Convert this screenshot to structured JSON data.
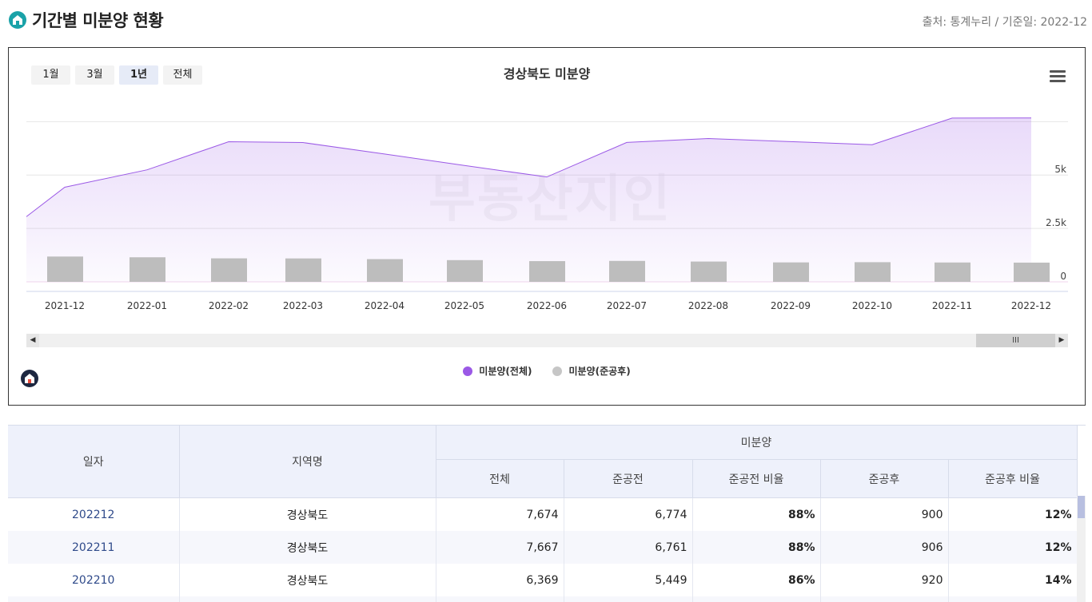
{
  "header": {
    "title": "기간별 미분양 현황",
    "source": "출처: 통계누리 / 기준일: 2022-12"
  },
  "range_buttons": [
    {
      "label": "1월",
      "active": false
    },
    {
      "label": "3월",
      "active": false
    },
    {
      "label": "1년",
      "active": true
    },
    {
      "label": "전체",
      "active": false
    }
  ],
  "watermark": "부동산지인",
  "chart_data": {
    "type": "area",
    "title": "경상북도 미분양",
    "categories": [
      "2021-12",
      "2022-01",
      "2022-02",
      "2022-03",
      "2022-04",
      "2022-05",
      "2022-06",
      "2022-07",
      "2022-08",
      "2022-09",
      "2022-10",
      "2022-11",
      "2022-12"
    ],
    "y_ticks": [
      "0",
      "2.5k",
      "5k"
    ],
    "ylim": [
      0,
      7850
    ],
    "series": [
      {
        "name": "미분양(전체)",
        "type": "area",
        "color": "#9b59e6",
        "values": [
          4431,
          5245,
          6560,
          6522,
          null,
          null,
          4910,
          6527,
          6711,
          null,
          6420,
          7667,
          7674
        ]
      },
      {
        "name": "미분양(준공후)",
        "type": "bar",
        "color": "#bdbdbd",
        "values": [
          1184,
          1150,
          1100,
          1096,
          1064,
          1016,
          970,
          980,
          950,
          910,
          920,
          906,
          900
        ]
      }
    ],
    "line_extra_points": [
      {
        "x": "2021-12",
        "y_start": 3050
      }
    ],
    "grid": true,
    "legend": "bottom"
  },
  "table": {
    "headers": {
      "date": "일자",
      "region": "지역명",
      "group": "미분양",
      "total": "전체",
      "pre": "준공전",
      "pre_ratio": "준공전 비율",
      "post": "준공후",
      "post_ratio": "준공후 비율"
    },
    "rows": [
      {
        "date": "202212",
        "region": "경상북도",
        "total": "7,674",
        "pre": "6,774",
        "pre_ratio": "88%",
        "post": "900",
        "post_ratio": "12%"
      },
      {
        "date": "202211",
        "region": "경상북도",
        "total": "7,667",
        "pre": "6,761",
        "pre_ratio": "88%",
        "post": "906",
        "post_ratio": "12%"
      },
      {
        "date": "202210",
        "region": "경상북도",
        "total": "6,369",
        "pre": "5,449",
        "pre_ratio": "86%",
        "post": "920",
        "post_ratio": "14%"
      },
      {
        "date": "",
        "region": "",
        "total": "",
        "pre": "",
        "pre_ratio": "",
        "post": "",
        "post_ratio": ""
      }
    ]
  },
  "colors": {
    "accent": "#1aa2a8",
    "line": "#9b59e6",
    "bar": "#bdbdbd"
  }
}
